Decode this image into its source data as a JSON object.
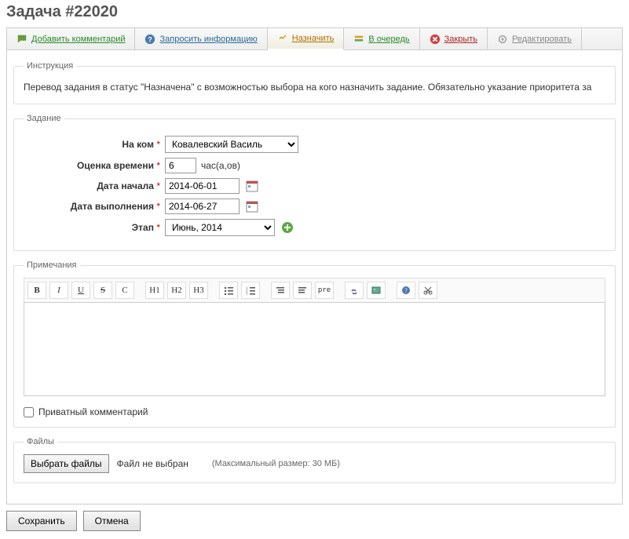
{
  "page_title": "Задача #22020",
  "tabs": {
    "comment": "Добавить комментарий",
    "request": "Запросить информацию",
    "assign": "Назначить",
    "queue": "В очередь",
    "close": "Закрыть",
    "edit": "Редактировать"
  },
  "instruction": {
    "legend": "Инструкция",
    "text": "Перевод задания в статус \"Назначена\" с возможностью выбора на кого назначить задание. Обязательно указание приоритета за"
  },
  "task": {
    "legend": "Задание",
    "labels": {
      "assignee": "На ком",
      "estimate": "Оценка времени",
      "start": "Дата начала",
      "due": "Дата выполнения",
      "stage": "Этап"
    },
    "values": {
      "assignee": "Ковалевский Василь",
      "estimate": "6",
      "estimate_unit": "час(а,ов)",
      "start": "2014-06-01",
      "due": "2014-06-27",
      "stage": "Июнь, 2014"
    }
  },
  "notes": {
    "legend": "Примечания",
    "private_label": "Приватный комментарий"
  },
  "toolbar": {
    "bold": "B",
    "italic": "I",
    "underline": "U",
    "strike": "S",
    "code": "C",
    "h1": "H1",
    "h2": "H2",
    "h3": "H3",
    "pre": "pre"
  },
  "files": {
    "legend": "Файлы",
    "choose": "Выбрать файлы",
    "status": "Файл не выбран",
    "max": "(Максимальный размер: 30 МБ)"
  },
  "buttons": {
    "save": "Сохранить",
    "cancel": "Отмена"
  }
}
